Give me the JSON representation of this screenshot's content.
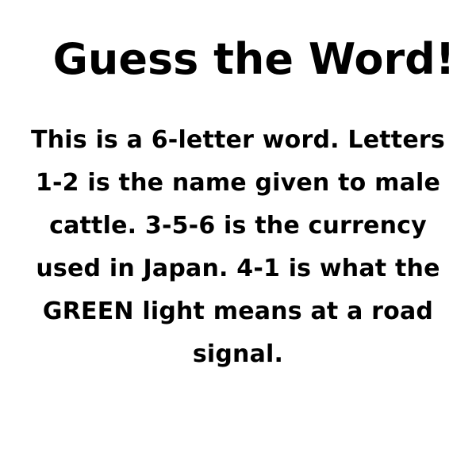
{
  "title": "Guess the Word!",
  "puzzle_text": "This is a 6-letter word. Letters 1-2 is the name given to male cattle. 3-5-6 is the currency used in Japan. 4-1 is what the GREEN light means at a road signal."
}
